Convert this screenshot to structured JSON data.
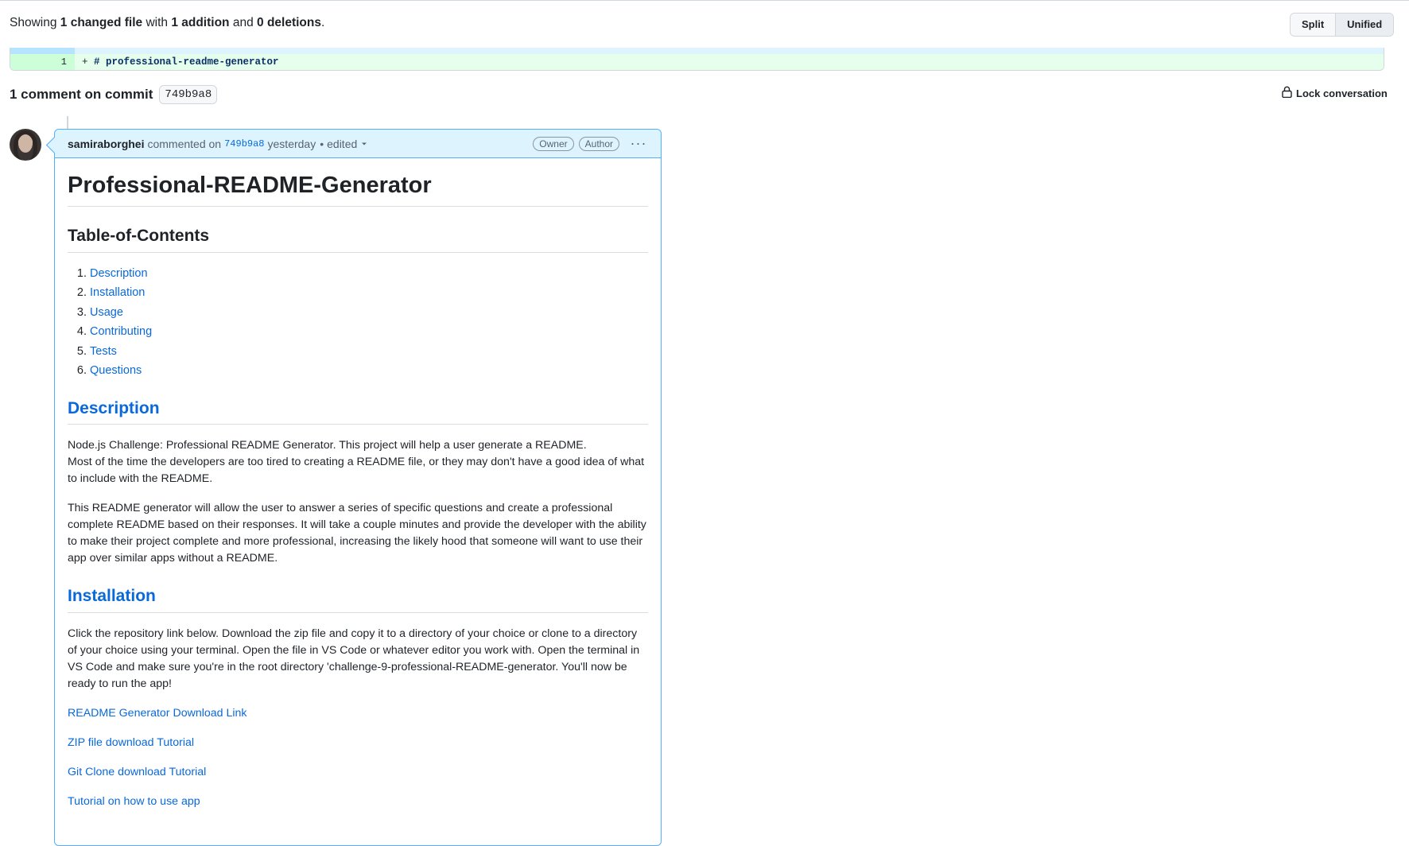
{
  "summary": {
    "prefix": "Showing ",
    "changed": "1 changed file",
    "with": " with ",
    "additions": "1 addition",
    "and": " and ",
    "deletions": "0 deletions",
    "suffix": "."
  },
  "view_toggle": {
    "split": "Split",
    "unified": "Unified",
    "active": "unified"
  },
  "diff": {
    "line_number": "1",
    "marker": "+ ",
    "content": "# professional-readme-generator"
  },
  "comments_header": {
    "title": "1 comment on commit",
    "sha": "749b9a8",
    "lock_label": "Lock conversation"
  },
  "comment": {
    "author": "samiraborghei",
    "action": "commented on",
    "sha": "749b9a8",
    "time": "yesterday",
    "separator": "•",
    "edited": "edited",
    "badges": [
      "Owner",
      "Author"
    ],
    "menu": "···",
    "body": {
      "h1": "Professional-README-Generator",
      "toc_heading": "Table-of-Contents",
      "toc": [
        "Description",
        "Installation",
        "Usage",
        "Contributing",
        "Tests",
        "Questions"
      ],
      "description_heading": "Description",
      "description_p1_line1": "Node.js Challenge: Professional README Generator. This project will help a user generate a README.",
      "description_p1_line2": "Most of the time the developers are too tired to creating a README file, or they may don't have a good idea of what to include with the README.",
      "description_p2": "This README generator will allow the user to answer a series of specific questions and create a professional complete README based on their responses. It will take a couple minutes and provide the developer with the ability to make their project complete and more professional, increasing the likely hood that someone will want to use their app over similar apps without a README.",
      "installation_heading": "Installation",
      "installation_p": "Click the repository link below. Download the zip file and copy it to a directory of your choice or clone to a directory of your choice using your terminal. Open the file in VS Code or whatever editor you work with. Open the terminal in VS Code and make sure you're in the root directory 'challenge-9-professional-README-generator. You'll now be ready to run the app!",
      "links": [
        "README Generator Download Link",
        "ZIP file download Tutorial",
        "Git Clone download Tutorial",
        "Tutorial on how to use app"
      ]
    }
  }
}
